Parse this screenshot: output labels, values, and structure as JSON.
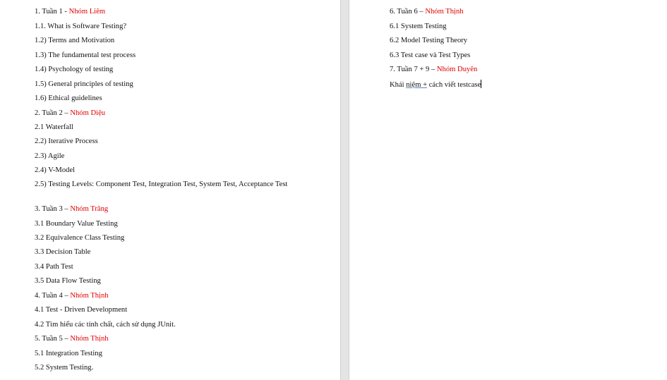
{
  "left_page": {
    "lines": [
      {
        "text": "1. Tuần 1 - ",
        "highlight": "Nhóm Liêm"
      },
      {
        "text": "1.1. What is Software Testing?"
      },
      {
        "text": "1.2) Terms and Motivation"
      },
      {
        "text": "1.3) The fundamental test process"
      },
      {
        "text": "1.4) Psychology of testing"
      },
      {
        "text": "1.5) General principles of testing"
      },
      {
        "text": "1.6) Ethical guidelines"
      },
      {
        "text": "2. Tuần 2 – ",
        "highlight": "Nhóm Diệu"
      },
      {
        "text": "2.1 Waterfall"
      },
      {
        "text": "2.2) Iterative Process"
      },
      {
        "text": "2.3) Agile"
      },
      {
        "text": "2.4) V-Model"
      },
      {
        "text": "2.5) Testing Levels: Component Test, Integration Test, System Test, Acceptance Test"
      },
      {
        "text": "3. Tuần 3 – ",
        "highlight": "Nhóm Trâng"
      },
      {
        "text": "3.1 Boundary Value Testing"
      },
      {
        "text": "3.2 Equivalence Class Testing"
      },
      {
        "text": "3.3 Decision Table"
      },
      {
        "text": "3.4 Path Test"
      },
      {
        "text": "3.5 Data Flow Testing"
      },
      {
        "text": "4. Tuần 4 – ",
        "highlight": "Nhóm Thịnh"
      },
      {
        "text": "4.1 Test - Driven Development"
      },
      {
        "text": "4.2 Tìm hiểu các tính chất, cách sử dụng JUnit."
      },
      {
        "text": "5. Tuần 5 – ",
        "highlight": "Nhóm Thịnh"
      },
      {
        "text": "5.1 Integration Testing"
      },
      {
        "text": "5.2 System Testing."
      }
    ]
  },
  "right_page": {
    "lines": [
      {
        "text": "6. Tuần 6 – ",
        "highlight": "Nhóm Thịnh"
      },
      {
        "text": "6.1 System Testing"
      },
      {
        "text": "6.2 Model Testing Theory"
      },
      {
        "text": "6.3 Test case và Test Types"
      },
      {
        "text": "7. Tuần 7 + 9 – ",
        "highlight": "Nhóm Duyên"
      }
    ],
    "last_line": {
      "prefix": "Khái ",
      "underlined": "niệm  +",
      "suffix": " cách viết testcase"
    }
  },
  "colors": {
    "text": "#111111",
    "highlight": "#e00000",
    "gutter": "#e4e4e4"
  }
}
